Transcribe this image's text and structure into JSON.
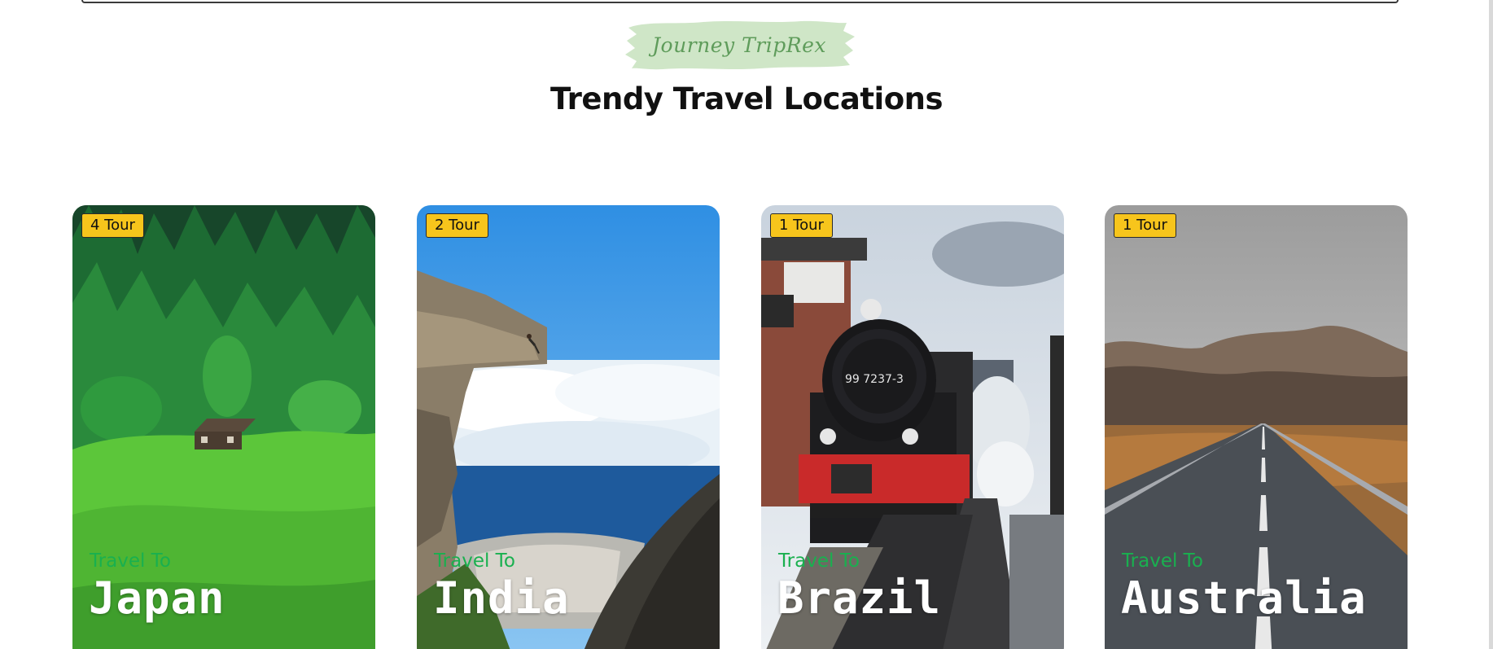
{
  "brand": {
    "name": "Journey TripRex",
    "badge_color": "#cfe6c7"
  },
  "section": {
    "title": "Trendy Travel Locations"
  },
  "destinations": [
    {
      "badge": "4 Tour",
      "prefix": "Travel To",
      "country": "Japan",
      "scene": "forest-cabin-meadow"
    },
    {
      "badge": "2 Tour",
      "prefix": "Travel To",
      "country": "India",
      "scene": "cliff-above-clouds-coastal-city"
    },
    {
      "badge": "1 Tour",
      "prefix": "Travel To",
      "country": "Brazil",
      "scene": "steam-locomotive-station"
    },
    {
      "badge": "1 Tour",
      "prefix": "Travel To",
      "country": "Australia",
      "scene": "desert-road-mountains"
    }
  ],
  "colors": {
    "badge": "#f7c51c",
    "accent_green": "#19b04f"
  }
}
